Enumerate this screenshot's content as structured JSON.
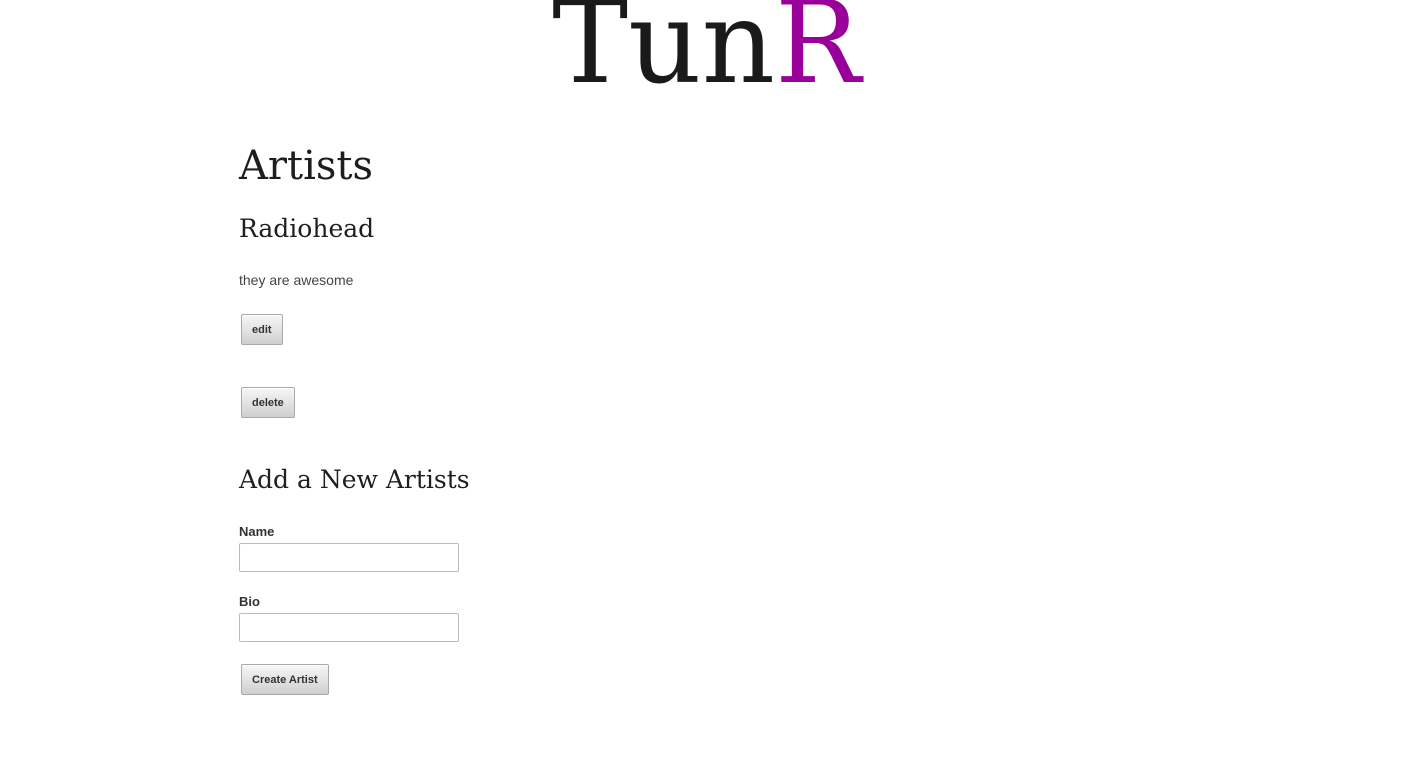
{
  "logo": {
    "part1": "Tun",
    "part2": "R",
    "accent_color": "#990099"
  },
  "page": {
    "title": "Artists"
  },
  "artists": [
    {
      "name": "Radiohead",
      "bio": "they are awesome",
      "edit_label": "edit",
      "delete_label": "delete"
    }
  ],
  "form": {
    "title": "Add a New Artists",
    "name_label": "Name",
    "name_value": "",
    "bio_label": "Bio",
    "bio_value": "",
    "submit_label": "Create Artist"
  }
}
